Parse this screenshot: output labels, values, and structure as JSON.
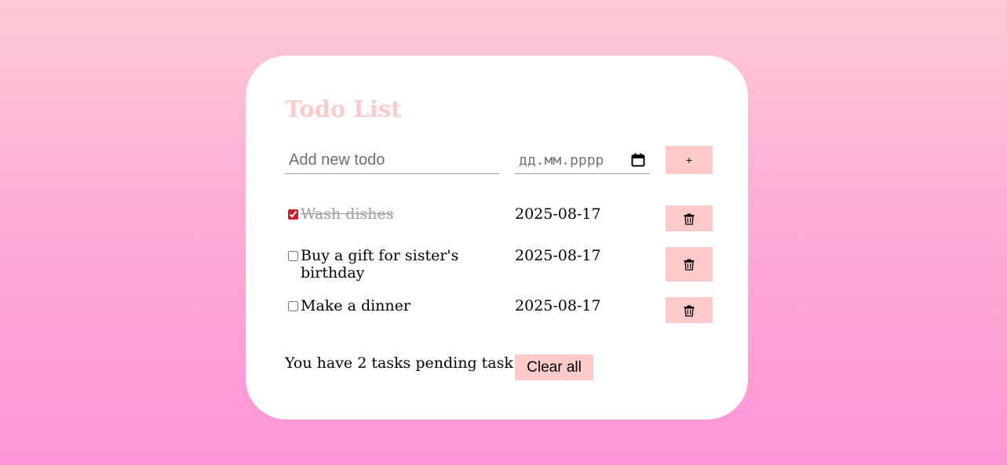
{
  "app": {
    "title": "Todo List"
  },
  "form": {
    "todo_placeholder": "Add new todo",
    "todo_value": "",
    "date_placeholder": "дд.мм.рррр",
    "add_label": "+"
  },
  "todos": [
    {
      "text": "Wash dishes",
      "date": "2025-08-17",
      "done": true
    },
    {
      "text": "Buy a gift for sister's birthday",
      "date": "2025-08-17",
      "done": false
    },
    {
      "text": "Make a dinner",
      "date": "2025-08-17",
      "done": false
    }
  ],
  "footer": {
    "pending_text": "You have 2 tasks pending task",
    "clear_label": "Clear all"
  },
  "icons": {
    "calendar": "calendar-icon",
    "delete": "trash-icon"
  },
  "colors": {
    "accent": "#ffcaca",
    "checked": "#d11a2a",
    "done_text": "#9e9e9e"
  }
}
